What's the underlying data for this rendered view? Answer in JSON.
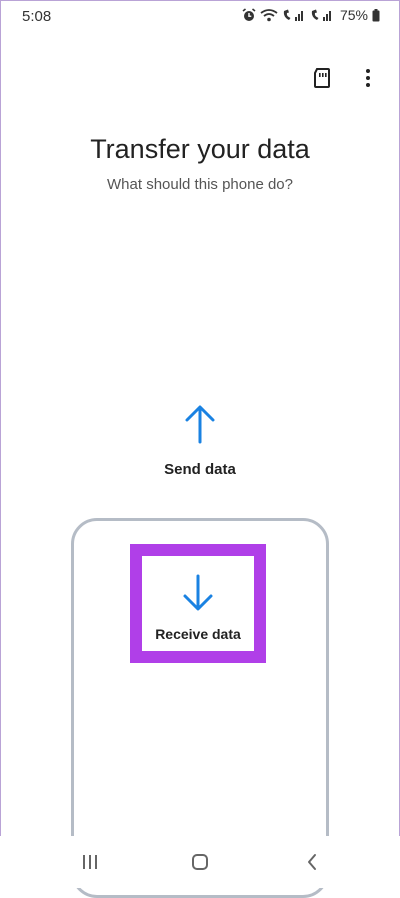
{
  "status_bar": {
    "time": "5:08",
    "battery": "75%",
    "icons": [
      "alarm-icon",
      "wifi-calling-icon",
      "signal-icon",
      "signal-icon",
      "battery-icon"
    ]
  },
  "toolbar": {
    "icons": [
      "sd-card-icon",
      "more-options-icon"
    ]
  },
  "header": {
    "title": "Transfer your data",
    "subtitle": "What should this phone do?"
  },
  "options": {
    "send": {
      "label": "Send data",
      "icon": "arrow-up-icon"
    },
    "receive": {
      "label": "Receive data",
      "icon": "arrow-down-icon"
    }
  },
  "colors": {
    "accent_blue": "#1a82e2",
    "highlight_purple": "#b03fe8",
    "outline_gray": "#b5bcc6"
  },
  "nav_bar": {
    "icons": [
      "recents-icon",
      "home-icon",
      "back-icon"
    ]
  }
}
